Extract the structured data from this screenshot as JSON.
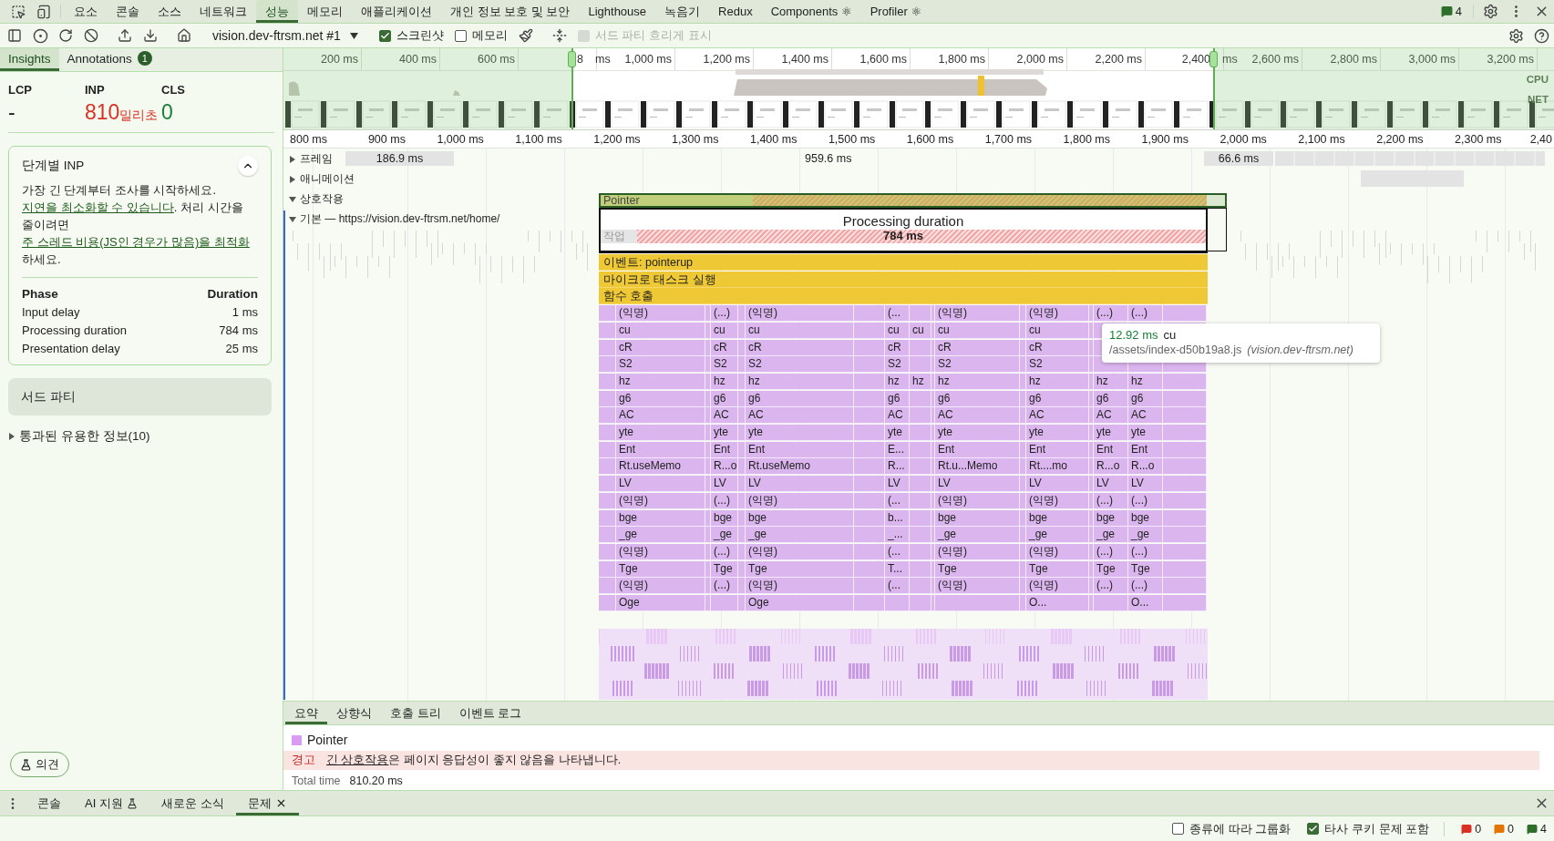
{
  "top_tabs": [
    {
      "label": "요소",
      "selected": false
    },
    {
      "label": "콘솔",
      "selected": false
    },
    {
      "label": "소스",
      "selected": false
    },
    {
      "label": "네트워크",
      "selected": false
    },
    {
      "label": "성능",
      "selected": true
    },
    {
      "label": "메모리",
      "selected": false
    },
    {
      "label": "애플리케이션",
      "selected": false
    },
    {
      "label": "개인 정보 보호 및 보안",
      "selected": false
    },
    {
      "label": "Lighthouse",
      "selected": false
    },
    {
      "label": "녹음기",
      "selected": false
    },
    {
      "label": "Redux",
      "selected": false
    },
    {
      "label": "Components ⚛",
      "selected": false
    },
    {
      "label": "Profiler ⚛",
      "selected": false
    }
  ],
  "issues_count": "4",
  "toolbar": {
    "recording": "vision.dev-ftrsm.net #1",
    "screenshots": {
      "label": "스크린샷",
      "checked": true
    },
    "memory": {
      "label": "메모리",
      "checked": false
    },
    "third_party": {
      "label": "서드 파티 흐리게 표시",
      "disabled": true
    }
  },
  "sidebar": {
    "tabs": [
      {
        "label": "Insights",
        "selected": true
      },
      {
        "label": "Annotations",
        "badge": "1",
        "selected": false
      }
    ],
    "metrics": [
      {
        "name": "LCP",
        "value": "-",
        "color": "#1f1f1f"
      },
      {
        "name": "INP",
        "value": "810",
        "unit": "밀리초",
        "color": "#d93025"
      },
      {
        "name": "CLS",
        "value": "0",
        "color": "#188038"
      }
    ],
    "inp_card": {
      "title": "단계별 INP",
      "expanded": true,
      "description": [
        {
          "text": "가장 긴 단계부터 조사를 시작하세요. ",
          "link": false
        },
        {
          "text": "지연을 최소화할 수 있습니다",
          "link": true
        },
        {
          "text": ". 처리 시간을 줄이려면 ",
          "link": false
        },
        {
          "text": "주 스레드 비용(JS인 경우가 많음)을 최적화",
          "link": true
        },
        {
          "text": "하세요.",
          "link": false
        }
      ],
      "columns": [
        "Phase",
        "Duration"
      ],
      "rows": [
        [
          "Input delay",
          "1 ms"
        ],
        [
          "Processing duration",
          "784 ms"
        ],
        [
          "Presentation delay",
          "25 ms"
        ]
      ]
    },
    "third_party": "서드 파티",
    "passed": {
      "label": "통과된 유용한 정보(10)",
      "expanded": false
    },
    "feedback": "의견"
  },
  "overview": {
    "ticks": [
      {
        "label": "200 ms"
      },
      {
        "label": "400 ms"
      },
      {
        "label": "600 ms"
      },
      {
        "label": "8",
        "tail": "ms"
      },
      {
        "label": "1,000 ms"
      },
      {
        "label": "1,200 ms"
      },
      {
        "label": "1,400 ms"
      },
      {
        "label": "1,600 ms"
      },
      {
        "label": "1,800 ms"
      },
      {
        "label": "2,000 ms"
      },
      {
        "label": "2,200 ms"
      },
      {
        "label": "2,400",
        "tail": "ms"
      },
      {
        "label": "2,600 ms"
      },
      {
        "label": "2,800 ms"
      },
      {
        "label": "3,000 ms"
      },
      {
        "label": "3,200 ms"
      }
    ],
    "lanes": [
      "CPU",
      "NET"
    ]
  },
  "ruler": [
    "800 ms",
    "900 ms",
    "1,000 ms",
    "1,100 ms",
    "1,200 ms",
    "1,300 ms",
    "1,400 ms",
    "1,500 ms",
    "1,600 ms",
    "1,700 ms",
    "1,800 ms",
    "1,900 ms",
    "2,000 ms",
    "2,100 ms",
    "2,200 ms",
    "2,300 ms",
    "2,40"
  ],
  "tracks": {
    "frames": {
      "label": "프레임",
      "expanded": false,
      "durations": [
        "186.9 ms",
        "959.6 ms",
        "66.6 ms"
      ]
    },
    "animations": {
      "label": "애니메이션",
      "expanded": false
    },
    "interactions": {
      "label": "상호작용",
      "expanded": true,
      "bar": "Pointer"
    },
    "main": {
      "label": "기본 — https://vision.dev-ftrsm.net/home/",
      "expanded": true
    }
  },
  "overlay": {
    "title": "Processing duration",
    "value": "784 ms"
  },
  "flame": {
    "task": "작업",
    "event": "이벤트: pointerup",
    "microtask": "마이크로 태스크 실행",
    "call": "함수 호출",
    "rows": [
      [
        "(익명)",
        "(...)",
        "(익명)",
        "(...",
        null,
        "(익명)",
        "(익명)",
        "(...)",
        "(...)"
      ],
      [
        "cu",
        "cu",
        "cu",
        "cu",
        "cu",
        "cu",
        "cu",
        null,
        null
      ],
      [
        "cR",
        "cR",
        "cR",
        "cR",
        null,
        "cR",
        "cR",
        null,
        null
      ],
      [
        "S2",
        "S2",
        "S2",
        "S2",
        null,
        "S2",
        "S2",
        null,
        null
      ],
      [
        "hz",
        "hz",
        "hz",
        "hz",
        "hz",
        "hz",
        "hz",
        "hz",
        "hz"
      ],
      [
        "g6",
        "g6",
        "g6",
        "g6",
        null,
        "g6",
        "g6",
        "g6",
        "g6"
      ],
      [
        "AC",
        "AC",
        "AC",
        "AC",
        null,
        "AC",
        "AC",
        "AC",
        "AC"
      ],
      [
        "yte",
        "yte",
        "yte",
        "yte",
        null,
        "yte",
        "yte",
        "yte",
        "yte"
      ],
      [
        "Ent",
        "Ent",
        "Ent",
        "E...",
        null,
        "Ent",
        "Ent",
        "Ent",
        "Ent"
      ],
      [
        "Rt.useMemo",
        "R...o",
        "Rt.useMemo",
        "R...",
        null,
        "Rt.u...Memo",
        "Rt....mo",
        "R...o",
        "R...o"
      ],
      [
        "LV",
        "LV",
        "LV",
        "LV",
        null,
        "LV",
        "LV",
        "LV",
        "LV"
      ],
      [
        "(익명)",
        "(...)",
        "(익명)",
        "(...",
        null,
        "(익명)",
        "(익명)",
        "(...)",
        "(...)"
      ],
      [
        "bge",
        "bge",
        "bge",
        "b...",
        null,
        "bge",
        "bge",
        "bge",
        "bge"
      ],
      [
        "_ge",
        "_ge",
        "_ge",
        "_...",
        null,
        "_ge",
        "_ge",
        "_ge",
        "_ge"
      ],
      [
        "(익명)",
        "(...)",
        "(익명)",
        "(...",
        null,
        "(익명)",
        "(익명)",
        "(...)",
        "(...)"
      ],
      [
        "Tge",
        "Tge",
        "Tge",
        "T...",
        null,
        "Tge",
        "Tge",
        "Tge",
        "Tge"
      ],
      [
        "(익명)",
        "(...)",
        "(익명)",
        "(...",
        null,
        "(익명)",
        "(익명)",
        "(...)",
        "(...)"
      ],
      [
        "Oge",
        null,
        "Oge",
        null,
        null,
        null,
        "O...",
        null,
        "O..."
      ]
    ]
  },
  "tooltip": {
    "time": "12.92 ms",
    "name": "cu",
    "url": "/assets/index-d50b19a8.js",
    "origin": "(vision.dev-ftrsm.net)"
  },
  "details": {
    "tabs": [
      {
        "label": "요약",
        "selected": true
      },
      {
        "label": "상향식",
        "selected": false
      },
      {
        "label": "호출 트리",
        "selected": false
      },
      {
        "label": "이벤트 로그",
        "selected": false
      }
    ],
    "title": "Pointer",
    "warning": {
      "label": "경고",
      "link": "긴 상호작용",
      "text": "은 페이지 응답성이 좋지 않음을 나타냅니다."
    },
    "total": {
      "label": "Total time",
      "value": "810.20 ms"
    }
  },
  "drawer": {
    "tabs": [
      {
        "label": "콘솔",
        "selected": false,
        "beta": false,
        "closable": false
      },
      {
        "label": "AI 지원",
        "selected": false,
        "beta": true,
        "closable": false
      },
      {
        "label": "새로운 소식",
        "selected": false,
        "beta": false,
        "closable": false
      },
      {
        "label": "문제",
        "selected": true,
        "beta": false,
        "closable": true
      }
    ]
  },
  "status": {
    "group_by_kind": {
      "label": "종류에 따라 그룹화",
      "checked": false
    },
    "third_party_cookies": {
      "label": "타사 쿠키 문제 포함",
      "checked": true
    },
    "errors": "0",
    "warnings": "0",
    "infos": "4"
  }
}
